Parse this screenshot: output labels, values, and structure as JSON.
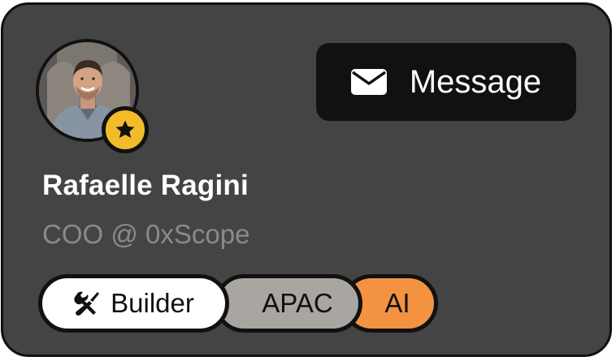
{
  "profile": {
    "name": "Rafaelle Ragini",
    "title": "COO @ 0xScope",
    "avatar_icon": "person-photo",
    "badge_icon": "star-icon"
  },
  "actions": {
    "message_label": "Message",
    "message_icon": "envelope-icon"
  },
  "tags": [
    {
      "label": "Builder",
      "icon": "tools-icon",
      "color": "#ffffff"
    },
    {
      "label": "APAC",
      "color": "#a9a6a2"
    },
    {
      "label": "AI",
      "color": "#f39342"
    }
  ],
  "colors": {
    "card_background": "#444444",
    "border": "#111111",
    "badge": "#f2bb2a",
    "button_background": "#111111",
    "subtitle_text": "#8a8a8a"
  }
}
